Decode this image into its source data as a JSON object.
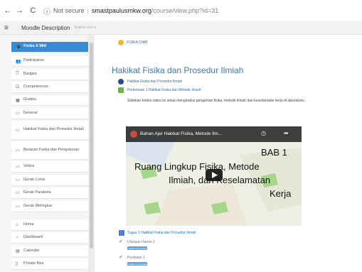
{
  "browser": {
    "back": "←",
    "forward": "→",
    "reload": "C",
    "info": "ⓘ",
    "not_secure": "Not secure",
    "domain": "smastpaulusmkw.org",
    "path": "/course/view.php?id=31"
  },
  "navbar": {
    "menu_icon": "≡",
    "title": "Moodle Description",
    "language": "English (en) ▾"
  },
  "sidebar": {
    "items": [
      {
        "label": "Fisika X MIA",
        "icon": "graduation-cap-icon",
        "glyph": "🎓",
        "active": true
      },
      {
        "label": "Participants",
        "icon": "users-icon",
        "glyph": "👥"
      },
      {
        "label": "Badges",
        "icon": "badge-icon",
        "glyph": "⛉"
      },
      {
        "label": "Competencies",
        "icon": "check-square-icon",
        "glyph": "☑"
      },
      {
        "label": "Grades",
        "icon": "grid-icon",
        "glyph": "▦"
      },
      {
        "label": "General",
        "icon": "folder-icon",
        "glyph": "▭"
      },
      {
        "label": "Hakikat Fisika dan Prosedur Ilmiah",
        "icon": "folder-icon",
        "glyph": "▭"
      },
      {
        "label": "Besaran Fisika dan Pengukuran",
        "icon": "folder-icon",
        "glyph": "▭"
      },
      {
        "label": "Vektor",
        "icon": "folder-icon",
        "glyph": "▭"
      },
      {
        "label": "Gerak Lurus",
        "icon": "folder-icon",
        "glyph": "▭"
      },
      {
        "label": "Gerak Parabola",
        "icon": "folder-icon",
        "glyph": "▭"
      },
      {
        "label": "Gerak Melingkar",
        "icon": "folder-icon",
        "glyph": "▭"
      },
      {
        "label": "Home",
        "icon": "home-icon",
        "glyph": "⌂"
      },
      {
        "label": "Dashboard",
        "icon": "dashboard-icon",
        "glyph": "◔"
      },
      {
        "label": "Calendar",
        "icon": "calendar-icon",
        "glyph": "▤"
      },
      {
        "label": "Private files",
        "icon": "file-icon",
        "glyph": "▯"
      }
    ]
  },
  "main": {
    "chat_link": "FISIKA CHAT",
    "section_title": "Hakikat Fisika dan Prosedur Ilmiah",
    "activities": [
      {
        "label": "Hakikat Fisika dan Prosedur Ilmiah"
      },
      {
        "label": "Pertemuan 1 Hakikat Fisika dan Metode Ilmiah"
      }
    ],
    "description": "Silahkan tonton video ini untuk mengetahui pengertian fisika, metode ilmiah dan keselamatan kerja di laboratoriu",
    "video": {
      "title": "Bahan Ajar Hakikat Fisika, Metode Ilm...",
      "chapter": "BAB 1",
      "line1": "Ruang Lingkup Fisika, Metode",
      "line2": "Ilmiah, dan Keselamatan",
      "line3": "Kerja"
    },
    "assignment": "Tugas 1 Hakikat Fisika dan Prosedur Ilmiah",
    "quizzes": [
      {
        "label": "Ulangan Harian 1",
        "badge": "Hidden from students"
      },
      {
        "label": "Penilaian 1",
        "badge": "Hidden from students"
      }
    ]
  },
  "colors": {
    "accent": "#3a8bd6",
    "link": "#2a6fba"
  }
}
